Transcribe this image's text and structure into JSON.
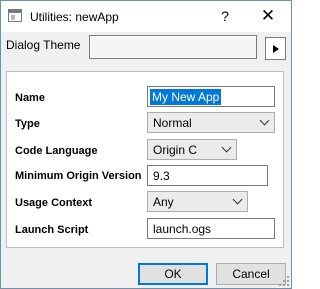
{
  "window": {
    "title": "Utilities: newApp",
    "help_label": "?",
    "close_label": "✕"
  },
  "dialog_theme": {
    "label": "Dialog Theme",
    "value": ""
  },
  "form": {
    "name": {
      "label": "Name",
      "value": "My New App"
    },
    "type": {
      "label": "Type",
      "value": "Normal"
    },
    "code_language": {
      "label": "Code Language",
      "value": "Origin C"
    },
    "min_version": {
      "label": "Minimum Origin Version",
      "value": "9.3"
    },
    "usage_context": {
      "label": "Usage Context",
      "value": "Any"
    },
    "launch_script": {
      "label": "Launch Script",
      "value": "launch.ogs"
    }
  },
  "buttons": {
    "ok_label": "OK",
    "cancel_label": "Cancel"
  },
  "colors": {
    "selection": "#0078d7",
    "border": "#7a7a7a"
  }
}
